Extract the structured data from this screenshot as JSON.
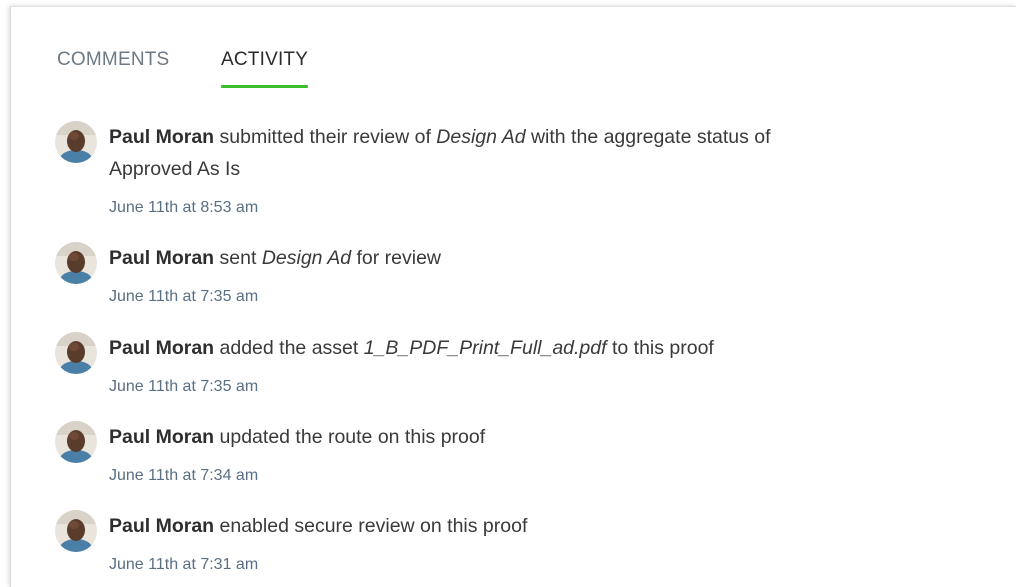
{
  "tabs": {
    "comments": "COMMENTS",
    "activity": "ACTIVITY",
    "active": "activity",
    "accent_color": "#3bbf2c"
  },
  "activity": [
    {
      "user": "Paul Moran",
      "pre": " submitted their review of ",
      "emph": "Design Ad",
      "post": " with the aggregate status of",
      "line2": "Approved As Is",
      "time": "June 11th at 8:53 am"
    },
    {
      "user": "Paul Moran",
      "pre": " sent ",
      "emph": "Design Ad",
      "post": " for review",
      "time": "June 11th at 7:35 am"
    },
    {
      "user": "Paul Moran",
      "pre": " added the asset ",
      "emph": "1_B_PDF_Print_Full_ad.pdf",
      "post": " to this proof",
      "time": "June 11th at 7:35 am"
    },
    {
      "user": "Paul Moran",
      "pre": " updated the route on this proof",
      "time": "June 11th at 7:34 am"
    },
    {
      "user": "Paul Moran",
      "pre": " enabled secure review on this proof",
      "time": "June 11th at 7:31 am"
    }
  ]
}
